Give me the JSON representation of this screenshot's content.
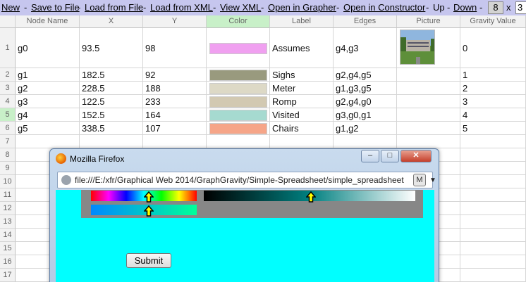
{
  "toolbar": {
    "new": "New",
    "save_file": "Save to File",
    "load_file": "Load from File",
    "load_xml": "Load from XML",
    "view_xml": "View XML",
    "open_grapher": "Open in Grapher",
    "open_constructor": "Open in Constructor",
    "up": "Up",
    "down": "Down",
    "rows_value": "8",
    "times": "x",
    "cols_value": "3",
    "sep": "-"
  },
  "grid": {
    "headers": [
      "Node Name",
      "X",
      "Y",
      "Color",
      "Label",
      "Edges",
      "Picture",
      "Gravity Value"
    ],
    "row_numbers": [
      "1",
      "2",
      "3",
      "4",
      "5",
      "6",
      "7",
      "8",
      "9",
      "10",
      "11",
      "12",
      "13",
      "14",
      "15",
      "16",
      "17"
    ],
    "rows": [
      {
        "name": "g0",
        "x": "93.5",
        "y": "98",
        "color": "#f0a0f0",
        "label": "Assumes",
        "edges": "g4,g3",
        "gravity": "0"
      },
      {
        "name": "g1",
        "x": "182.5",
        "y": "92",
        "color": "#999a7e",
        "label": "Sighs",
        "edges": "g2,g4,g5",
        "gravity": "1"
      },
      {
        "name": "g2",
        "x": "228.5",
        "y": "188",
        "color": "#ddd9c6",
        "label": "Meter",
        "edges": "g1,g3,g5",
        "gravity": "2"
      },
      {
        "name": "g3",
        "x": "122.5",
        "y": "233",
        "color": "#d2c9b2",
        "label": "Romp",
        "edges": "g2,g4,g0",
        "gravity": "3"
      },
      {
        "name": "g4",
        "x": "152.5",
        "y": "164",
        "color": "#a6dad0",
        "label": "Visited",
        "edges": "g3,g0,g1",
        "gravity": "4"
      },
      {
        "name": "g5",
        "x": "338.5",
        "y": "107",
        "color": "#f6a588",
        "label": "Chairs",
        "edges": "g1,g2",
        "gravity": "5"
      }
    ]
  },
  "firefox": {
    "title": "Mozilla Firefox",
    "url": "file:///E:/xfr/Graphical Web 2014/GraphGravity/Simple-Spreadsheet/simple_spreadsheet",
    "submit_label": "Submit"
  }
}
